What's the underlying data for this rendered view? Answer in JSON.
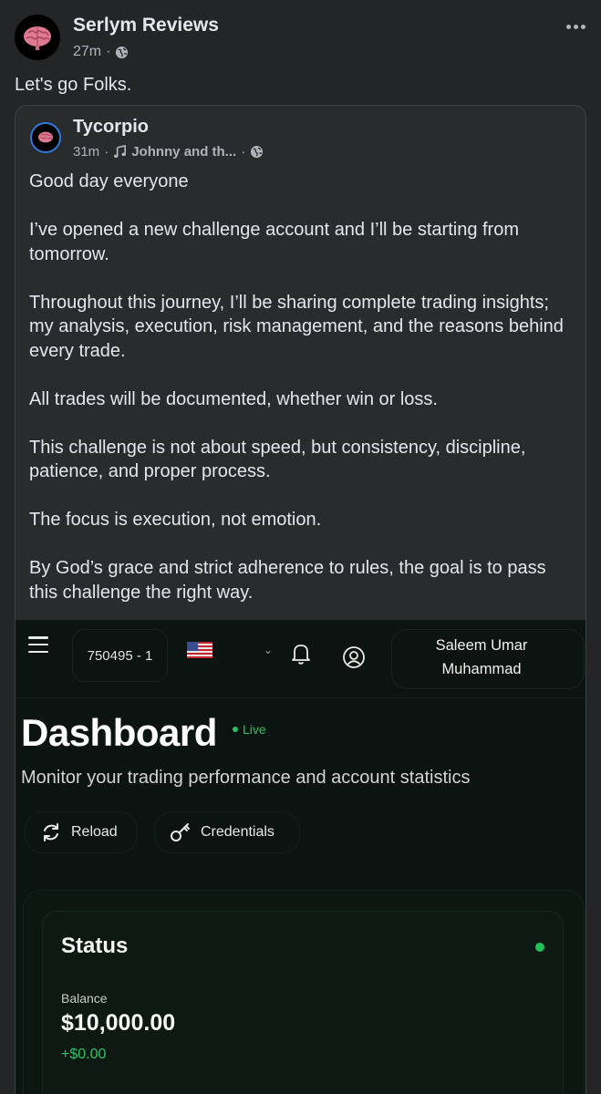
{
  "post": {
    "author": "Serlym Reviews",
    "time": "27m",
    "text": "Let's go Folks."
  },
  "shared": {
    "author": "Tycorpio",
    "time": "31m",
    "music": "Johnny and th...",
    "paragraphs": [
      "Good day everyone",
      "I’ve opened a new challenge account and I’ll be starting from tomorrow.",
      "Throughout this journey, I’ll be sharing complete trading insights; my analysis, execution, risk management, and the reasons behind every trade.",
      "All trades will be documented, whether win or loss.",
      "This challenge is not about speed, but consistency, discipline, patience, and proper process.",
      "The focus is execution, not emotion.",
      "By God’s grace and strict adherence to rules, the goal is to pass this challenge the right way."
    ]
  },
  "dashboard": {
    "account_id": "750495 - 1",
    "user_name": "Saleem Umar Muhammad",
    "title": "Dashboard",
    "live_label": "Live",
    "subtitle": "Monitor your trading performance and account statistics",
    "reload_label": "Reload",
    "credentials_label": "Credentials",
    "status_title": "Status",
    "balance_label": "Balance",
    "balance_value": "$10,000.00",
    "balance_change": "+$0.00"
  },
  "colors": {
    "background": "#242526",
    "card": "#2a2b2c",
    "text": "#e4e6eb",
    "muted": "#b0b3b8",
    "dashboard_bg": "#0b1410",
    "live_green": "#2fbf61"
  }
}
